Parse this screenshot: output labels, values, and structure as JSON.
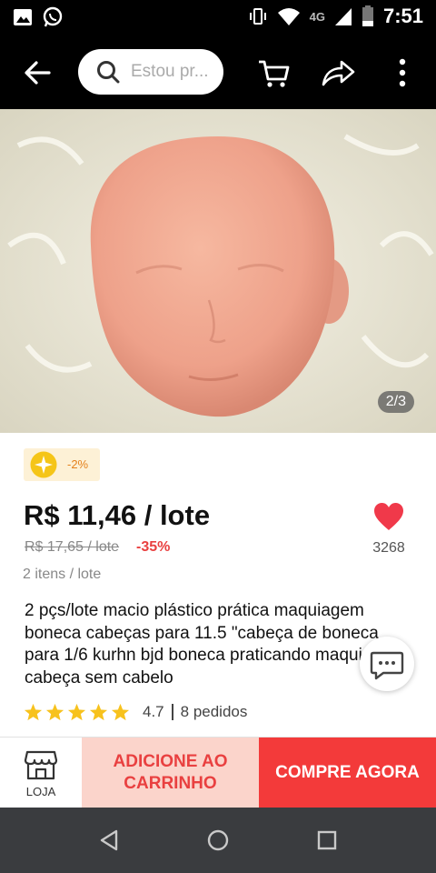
{
  "status_bar": {
    "time": "7:51",
    "network": "4G",
    "icons": [
      "image-icon",
      "whatsapp-icon",
      "vibrate-icon",
      "wifi-icon",
      "signal-icon",
      "battery-icon"
    ]
  },
  "header": {
    "search_text": "Estou pr...",
    "icons": [
      "back-arrow-icon",
      "search-icon",
      "cart-icon",
      "share-icon",
      "more-vertical-icon"
    ]
  },
  "gallery": {
    "counter": "2/3"
  },
  "coin_badge": {
    "text": "-2%"
  },
  "product": {
    "price": "R$ 11,46 / lote",
    "old_price": "R$ 17,65 / lote",
    "discount": "-35%",
    "lot_info": "2 itens / lote",
    "favorites": "3268",
    "title": "2 pçs/lote macio plástico prática maquiagem boneca cabeças para 11.5 \"cabeça de boneca para 1/6 kurhn bjd boneca praticando maquiagem cabeça sem cabelo",
    "rating_value": "4.7",
    "stars": 5,
    "orders": "8 pedidos"
  },
  "actions": {
    "store_label": "LOJA",
    "add_to_cart": "ADICIONE AO CARRINHO",
    "buy_now": "COMPRE AGORA"
  },
  "colors": {
    "accent": "#f33a3a",
    "heart": "#f0394a",
    "star": "#f7c21d",
    "cart_bg": "#fbd4cb",
    "coin": "#f5c518"
  }
}
